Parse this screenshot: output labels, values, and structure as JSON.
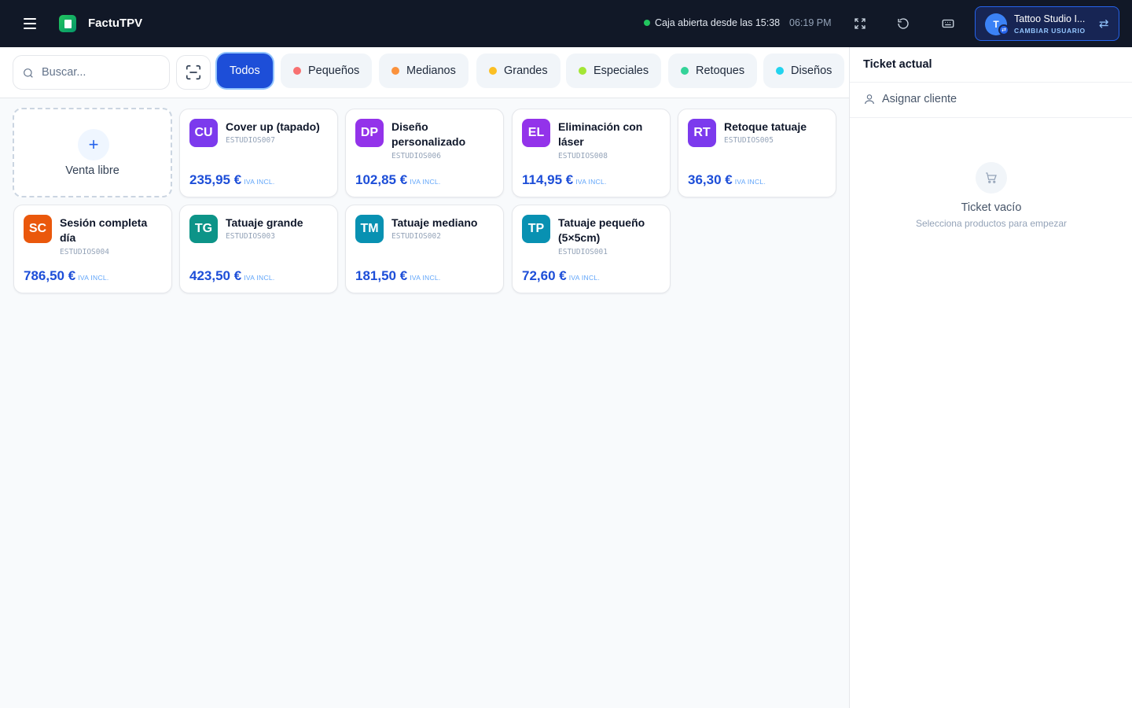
{
  "app": {
    "title": "FactuTPV"
  },
  "header": {
    "status_text": "Caja abierta desde las 15:38",
    "time": "06:19 PM",
    "user": {
      "initial": "T",
      "name": "Tattoo Studio I...",
      "action": "CAMBIAR USUARIO"
    }
  },
  "search": {
    "placeholder": "Buscar...",
    "value": ""
  },
  "categories": [
    {
      "label": "Todos",
      "active": true
    },
    {
      "label": "Pequeños",
      "color": "#f87171"
    },
    {
      "label": "Medianos",
      "color": "#fb923c"
    },
    {
      "label": "Grandes",
      "color": "#fbbf24"
    },
    {
      "label": "Especiales",
      "color": "#a3e635"
    },
    {
      "label": "Retoques",
      "color": "#34d399"
    },
    {
      "label": "Diseños",
      "color": "#22d3ee"
    }
  ],
  "free_sale": {
    "icon": "plus-icon",
    "label": "Venta libre"
  },
  "products": [
    {
      "initials": "CU",
      "name": "Cover up (tapado)",
      "code": "ESTUDIOS007",
      "price": "235,95 €",
      "tax": "IVA INCL.",
      "color": "#7c3aed"
    },
    {
      "initials": "DP",
      "name": "Diseño personalizado",
      "code": "ESTUDIOS006",
      "price": "102,85 €",
      "tax": "IVA INCL.",
      "color": "#9333ea"
    },
    {
      "initials": "EL",
      "name": "Eliminación con láser",
      "code": "ESTUDIOS008",
      "price": "114,95 €",
      "tax": "IVA INCL.",
      "color": "#9333ea"
    },
    {
      "initials": "RT",
      "name": "Retoque tatuaje",
      "code": "ESTUDIOS005",
      "price": "36,30 €",
      "tax": "IVA INCL.",
      "color": "#7c3aed"
    },
    {
      "initials": "SC",
      "name": "Sesión completa día",
      "code": "ESTUDIOS004",
      "price": "786,50 €",
      "tax": "IVA INCL.",
      "color": "#ea580c"
    },
    {
      "initials": "TG",
      "name": "Tatuaje grande",
      "code": "ESTUDIOS003",
      "price": "423,50 €",
      "tax": "IVA INCL.",
      "color": "#0d9488"
    },
    {
      "initials": "TM",
      "name": "Tatuaje mediano",
      "code": "ESTUDIOS002",
      "price": "181,50 €",
      "tax": "IVA INCL.",
      "color": "#0891b2"
    },
    {
      "initials": "TP",
      "name": "Tatuaje pequeño (5×5cm)",
      "code": "ESTUDIOS001",
      "price": "72,60 €",
      "tax": "IVA INCL.",
      "color": "#0891b2"
    }
  ],
  "ticket": {
    "title": "Ticket actual",
    "assign_label": "Asignar cliente",
    "empty_title": "Ticket vacío",
    "empty_subtitle": "Selecciona productos para empezar"
  }
}
